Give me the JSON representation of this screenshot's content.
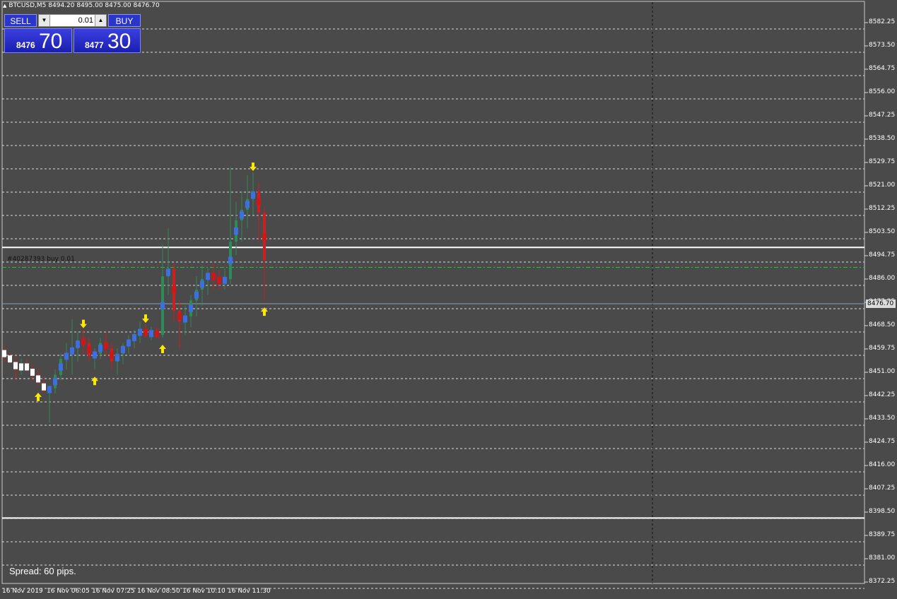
{
  "symbol_header": "BTCUSD,M5  8494.20 8495.00 8475.00 8476.70",
  "trade_panel": {
    "sell_label": "SELL",
    "buy_label": "BUY",
    "lot_value": "0.01",
    "sell_small": "8476",
    "sell_big": "70",
    "buy_small": "8477",
    "buy_big": "30"
  },
  "order_line_label": "#40287393 buy 0.01",
  "spread_text": "Spread: 60 pips.",
  "current_price": "8476.70",
  "price_axis": [
    "8582.25",
    "8573.50",
    "8564.75",
    "8556.00",
    "8547.25",
    "8538.50",
    "8529.75",
    "8521.00",
    "8512.25",
    "8503.50",
    "8494.75",
    "8486.00",
    "8477.25",
    "8468.50",
    "8459.75",
    "8451.00",
    "8442.25",
    "8433.50",
    "8424.75",
    "8416.00",
    "8407.25",
    "8398.50",
    "8389.75",
    "8381.00",
    "8372.25"
  ],
  "time_axis": [
    "16 Nov 2019",
    "16 Nov 06:05",
    "16 Nov 07:25",
    "16 Nov 08:50",
    "16 Nov 10:10",
    "16 Nov 11:30"
  ],
  "colors": {
    "background": "#4a4a4a",
    "bull_bar": "#2e8b57",
    "bear_bar": "#cc1f1f",
    "trend_up": "#3c6ee6",
    "trend_down": "#d41515",
    "neutral": "#ffffff",
    "signal_arrow": "#ffe800",
    "order_line": "#29c229"
  },
  "chart_data": {
    "type": "candlestick",
    "symbol": "BTCUSD",
    "timeframe": "M5",
    "ylim": [
      8370,
      8590
    ],
    "levels": {
      "support": 8400.0,
      "resistance": 8500.0,
      "order_price": 8492.5,
      "current": 8476.7
    },
    "candles": [
      [
        8459,
        8461,
        8455,
        8457
      ],
      [
        8457,
        8458,
        8454,
        8455
      ],
      [
        8455,
        8457,
        8448,
        8452
      ],
      [
        8452,
        8456,
        8450,
        8454
      ],
      [
        8454,
        8456,
        8451,
        8452
      ],
      [
        8452,
        8454,
        8448,
        8450
      ],
      [
        8450,
        8452,
        8446,
        8447
      ],
      [
        8447,
        8449,
        8443,
        8444
      ],
      [
        8444,
        8446,
        8432,
        8445
      ],
      [
        8445,
        8452,
        8443,
        8450
      ],
      [
        8450,
        8458,
        8448,
        8456
      ],
      [
        8456,
        8462,
        8452,
        8458
      ],
      [
        8458,
        8471,
        8450,
        8460
      ],
      [
        8460,
        8466,
        8455,
        8463
      ],
      [
        8463,
        8467,
        8458,
        8462
      ],
      [
        8462,
        8464,
        8455,
        8457
      ],
      [
        8457,
        8460,
        8452,
        8458
      ],
      [
        8458,
        8464,
        8456,
        8462
      ],
      [
        8462,
        8466,
        8457,
        8460
      ],
      [
        8460,
        8462,
        8452,
        8455
      ],
      [
        8455,
        8460,
        8450,
        8458
      ],
      [
        8458,
        8462,
        8454,
        8461
      ],
      [
        8461,
        8465,
        8458,
        8463
      ],
      [
        8463,
        8467,
        8460,
        8465
      ],
      [
        8465,
        8470,
        8462,
        8467
      ],
      [
        8467,
        8469,
        8464,
        8465
      ],
      [
        8465,
        8468,
        8463,
        8466
      ],
      [
        8466,
        8468,
        8464,
        8465
      ],
      [
        8465,
        8499,
        8464,
        8487
      ],
      [
        8487,
        8505,
        8480,
        8490
      ],
      [
        8490,
        8492,
        8470,
        8474
      ],
      [
        8474,
        8478,
        8460,
        8470
      ],
      [
        8470,
        8476,
        8465,
        8472
      ],
      [
        8472,
        8480,
        8468,
        8478
      ],
      [
        8478,
        8487,
        8472,
        8482
      ],
      [
        8482,
        8491,
        8476,
        8486
      ],
      [
        8486,
        8490,
        8480,
        8488
      ],
      [
        8488,
        8492,
        8482,
        8486
      ],
      [
        8486,
        8489,
        8482,
        8485
      ],
      [
        8485,
        8490,
        8482,
        8486
      ],
      [
        8486,
        8528,
        8484,
        8500
      ],
      [
        8500,
        8515,
        8495,
        8508
      ],
      [
        8508,
        8519,
        8500,
        8512
      ],
      [
        8512,
        8525,
        8505,
        8516
      ],
      [
        8516,
        8526,
        8510,
        8519
      ],
      [
        8519,
        8522,
        8500,
        8511
      ],
      [
        8511,
        8513,
        8478,
        8493
      ]
    ]
  }
}
